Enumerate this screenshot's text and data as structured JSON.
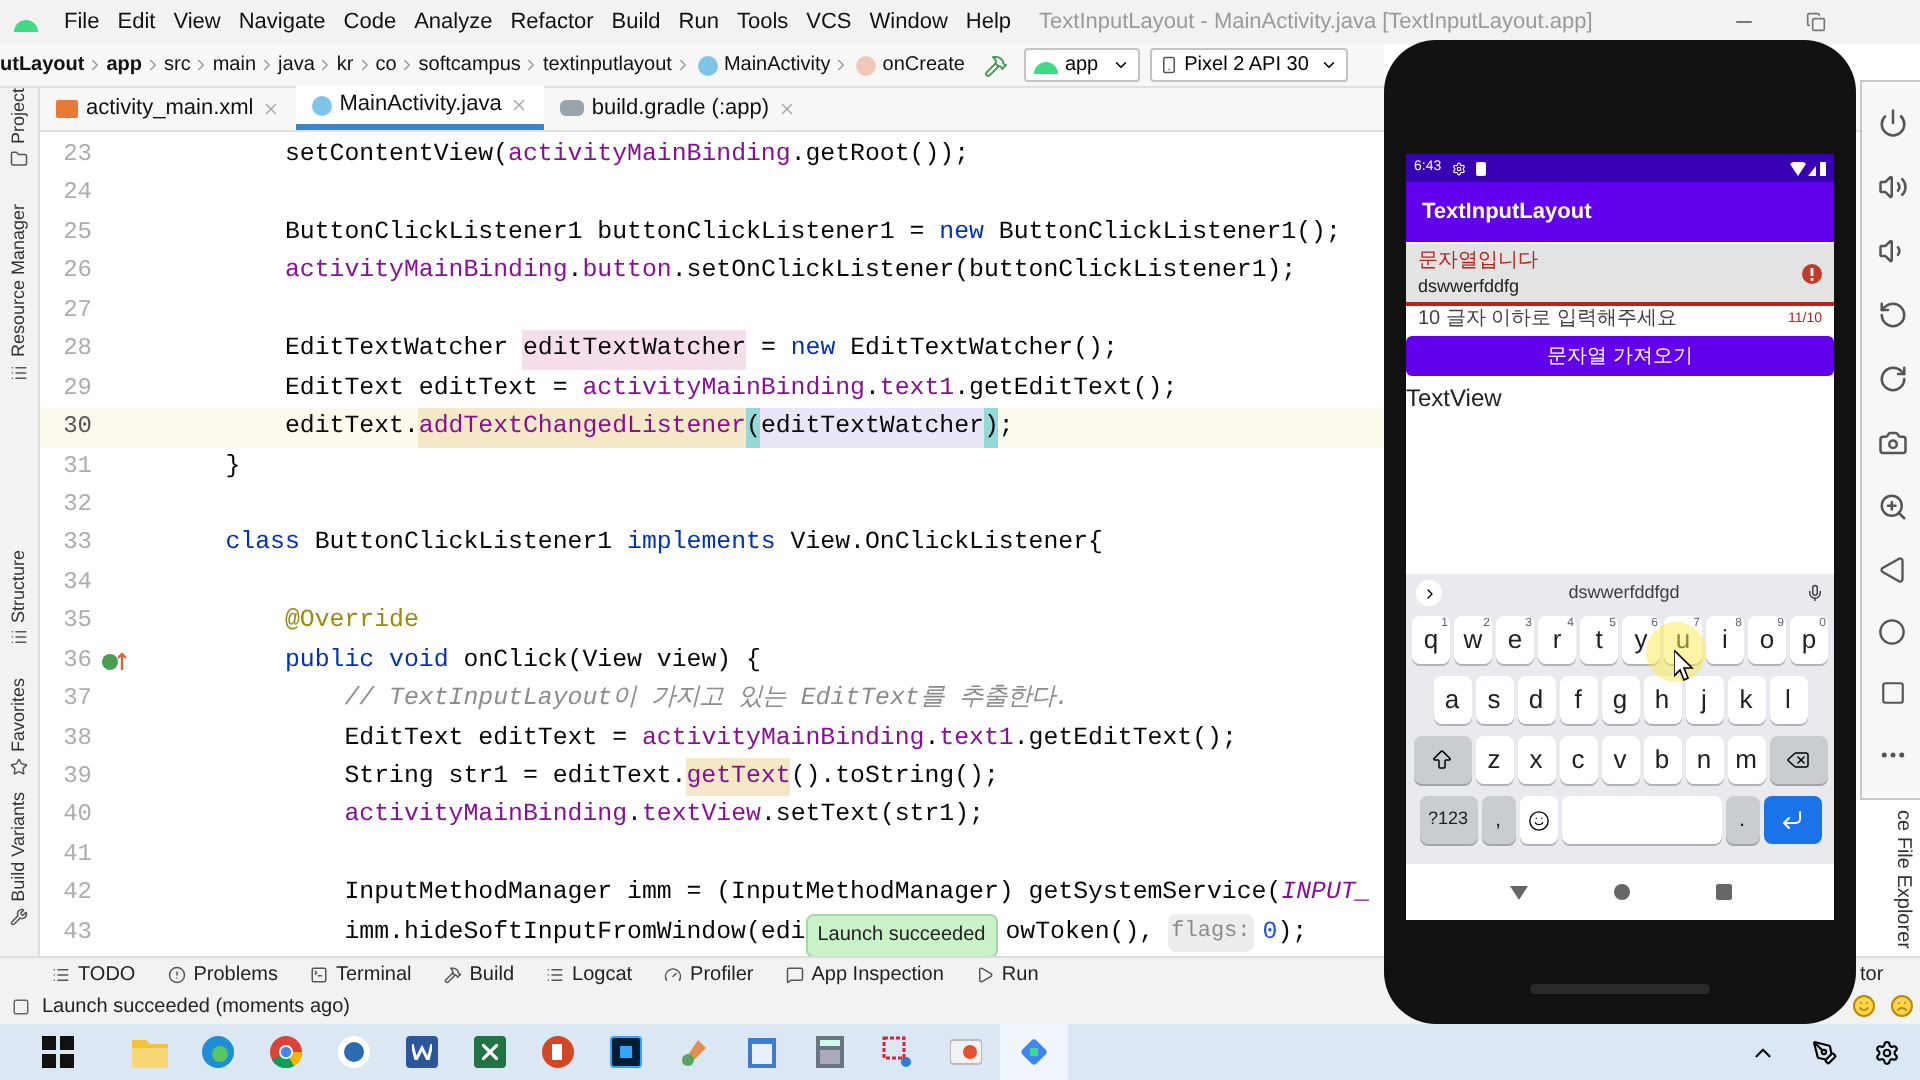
{
  "title_bar": {
    "menu": [
      "File",
      "Edit",
      "View",
      "Navigate",
      "Code",
      "Analyze",
      "Refactor",
      "Build",
      "Run",
      "Tools",
      "VCS",
      "Window",
      "Help"
    ],
    "title": "TextInputLayout - MainActivity.java [TextInputLayout.app]"
  },
  "nav_bar": {
    "breadcrumbs": [
      {
        "label": "utLayout",
        "kind": "project"
      },
      {
        "label": "app",
        "kind": "module"
      },
      {
        "label": "src",
        "kind": "dir"
      },
      {
        "label": "main",
        "kind": "dir"
      },
      {
        "label": "java",
        "kind": "dir"
      },
      {
        "label": "kr",
        "kind": "dir"
      },
      {
        "label": "co",
        "kind": "dir"
      },
      {
        "label": "softcampus",
        "kind": "dir"
      },
      {
        "label": "textinputlayout",
        "kind": "dir"
      },
      {
        "label": "MainActivity",
        "kind": "class"
      },
      {
        "label": "onCreate",
        "kind": "method"
      }
    ],
    "run_config": "app",
    "device": "Pixel 2 API 30"
  },
  "left_strip": [
    "Project",
    "Resource Manager",
    "Structure",
    "Favorites",
    "Build Variants"
  ],
  "tabs": [
    {
      "label": "activity_main.xml",
      "kind": "xml",
      "selected": false
    },
    {
      "label": "MainActivity.java",
      "kind": "class",
      "selected": true
    },
    {
      "label": "build.gradle (:app)",
      "kind": "gradle",
      "selected": false
    }
  ],
  "editor": {
    "lines": [
      {
        "num": "23",
        "current": false,
        "tokens": [
          {
            "text": "        setContentView(",
            "kind": "plain"
          },
          {
            "text": "activityMainBinding",
            "kind": "field"
          },
          {
            "text": ".getRoot());",
            "kind": "plain"
          }
        ]
      },
      {
        "num": "24",
        "current": false
      },
      {
        "num": "25",
        "current": false,
        "tokens": [
          {
            "text": "        ButtonClickListener1 buttonClickListener1 = ",
            "kind": "plain"
          },
          {
            "text": "new",
            "kind": "keyword"
          },
          {
            "text": " ButtonClickListener1();",
            "kind": "plain"
          }
        ]
      },
      {
        "num": "26",
        "current": false,
        "tokens": [
          {
            "text": "        activityMainBinding",
            "kind": "field"
          },
          {
            "text": ".",
            "kind": "plain"
          },
          {
            "text": "button",
            "kind": "field"
          },
          {
            "text": ".setOnClickListener(buttonClickListener1);",
            "kind": "plain"
          }
        ]
      },
      {
        "num": "27",
        "current": false
      },
      {
        "num": "28",
        "current": false,
        "tokens": [
          {
            "text": "        EditTextWatcher ",
            "kind": "plain"
          },
          {
            "text": "editTextWatcher",
            "kind": "declaration"
          },
          {
            "text": " = ",
            "kind": "plain"
          },
          {
            "text": "new",
            "kind": "keyword"
          },
          {
            "text": " EditTextWatcher();",
            "kind": "plain"
          }
        ]
      },
      {
        "num": "29",
        "current": false,
        "tokens": [
          {
            "text": "        EditText editText = ",
            "kind": "plain"
          },
          {
            "text": "activityMainBinding",
            "kind": "field"
          },
          {
            "text": ".",
            "kind": "plain"
          },
          {
            "text": "text1",
            "kind": "field"
          },
          {
            "text": ".getEditText();",
            "kind": "plain"
          }
        ]
      },
      {
        "num": "30",
        "current": true,
        "tokens": [
          {
            "text": "        editText.",
            "kind": "plain"
          },
          {
            "text": "addTextChangedListener",
            "kind": "usage"
          },
          {
            "text": "(",
            "kind": "brace"
          },
          {
            "text": "editTextWatcher",
            "kind": "argument"
          },
          {
            "text": ")",
            "kind": "brace"
          },
          {
            "text": ";",
            "kind": "plain"
          }
        ]
      },
      {
        "num": "31",
        "current": false,
        "tokens": [
          {
            "text": "    }",
            "kind": "plain"
          }
        ]
      },
      {
        "num": "32",
        "current": false
      },
      {
        "num": "33",
        "current": false,
        "tokens": [
          {
            "text": "    class",
            "kind": "keyword"
          },
          {
            "text": " ButtonClickListener1 ",
            "kind": "plain"
          },
          {
            "text": "implements",
            "kind": "keyword"
          },
          {
            "text": " View.OnClickListener{",
            "kind": "plain"
          }
        ]
      },
      {
        "num": "34",
        "current": false
      },
      {
        "num": "35",
        "current": false,
        "tokens": [
          {
            "text": "        @Override",
            "kind": "annotation"
          }
        ]
      },
      {
        "num": "36",
        "current": false,
        "gutter": {
          "kind": "override"
        },
        "tokens": [
          {
            "text": "        public",
            "kind": "keyword"
          },
          {
            "text": " void",
            "kind": "keyword"
          },
          {
            "text": " onClick(View view) {",
            "kind": "plain"
          }
        ]
      },
      {
        "num": "37",
        "current": false,
        "tokens": [
          {
            "text": "            // TextInputLayout이 가지고 있는 EditText를 추출한다.",
            "kind": "comment"
          }
        ]
      },
      {
        "num": "38",
        "current": false,
        "tokens": [
          {
            "text": "            EditText editText = ",
            "kind": "plain"
          },
          {
            "text": "activityMainBinding",
            "kind": "field"
          },
          {
            "text": ".",
            "kind": "plain"
          },
          {
            "text": "text1",
            "kind": "field"
          },
          {
            "text": ".getEditText();",
            "kind": "plain"
          }
        ]
      },
      {
        "num": "39",
        "current": false,
        "tokens": [
          {
            "text": "            String str1 = editText.",
            "kind": "plain"
          },
          {
            "text": "getText",
            "kind": "usage"
          },
          {
            "text": "().toString();",
            "kind": "plain"
          }
        ]
      },
      {
        "num": "40",
        "current": false,
        "tokens": [
          {
            "text": "            activityMainBinding",
            "kind": "field"
          },
          {
            "text": ".",
            "kind": "plain"
          },
          {
            "text": "textView",
            "kind": "field"
          },
          {
            "text": ".setText(str1);",
            "kind": "plain"
          }
        ]
      },
      {
        "num": "41",
        "current": false
      },
      {
        "num": "42",
        "current": false,
        "tokens": [
          {
            "text": "            InputMethodManager imm = (InputMethodManager) getSystemService(",
            "kind": "plain"
          },
          {
            "text": "INPUT_",
            "kind": "constant"
          }
        ]
      },
      {
        "num": "43",
        "current": false,
        "tokens": [
          {
            "text": "            imm.hideSoftInputFromWindow(edi",
            "kind": "plain"
          }
        ],
        "tooltip": "Launch succeeded",
        "tokens_after": [
          {
            "text": "owToken(),",
            "kind": "plain"
          },
          {
            "text": "flags:",
            "kind": "hint"
          },
          {
            "text": "0",
            "kind": "number"
          },
          {
            "text": ");",
            "kind": "plain"
          }
        ]
      }
    ]
  },
  "tool_windows": [
    "TODO",
    "Problems",
    "Terminal",
    "Build",
    "Logcat",
    "Profiler",
    "App Inspection",
    "Run"
  ],
  "status_bar": {
    "message": "Launch succeeded (moments ago)",
    "right_fragment": "tor"
  },
  "right_strip": {
    "label": "ce File Explorer"
  },
  "phone": {
    "time": "6:43",
    "app_title": "TextInputLayout",
    "field": {
      "label": "문자열입니다",
      "value": "dswwerfddfg",
      "error": true,
      "helper": "10 글자 이하로 입력해주세요",
      "counter": "11/10"
    },
    "button": "문자열 가져오기",
    "text_view": "TextView",
    "keyboard": {
      "suggestion": "dswwerfddfgd",
      "rows": [
        {
          "keys": [
            {
              "kind": "key",
              "label": "q",
              "hint": "1"
            },
            {
              "kind": "key",
              "label": "w",
              "hint": "2"
            },
            {
              "kind": "key",
              "label": "e",
              "hint": "3"
            },
            {
              "kind": "key",
              "label": "r",
              "hint": "4"
            },
            {
              "kind": "key",
              "label": "t",
              "hint": "5"
            },
            {
              "kind": "key",
              "label": "y",
              "hint": "6"
            },
            {
              "kind": "key",
              "label": "u",
              "hint": "7"
            },
            {
              "kind": "key",
              "label": "i",
              "hint": "8"
            },
            {
              "kind": "key",
              "label": "o",
              "hint": "9"
            },
            {
              "kind": "key",
              "label": "p",
              "hint": "0"
            }
          ]
        },
        {
          "keys": [
            {
              "kind": "key",
              "label": "a"
            },
            {
              "kind": "key",
              "label": "s"
            },
            {
              "kind": "key",
              "label": "d"
            },
            {
              "kind": "key",
              "label": "f"
            },
            {
              "kind": "key",
              "label": "g"
            },
            {
              "kind": "key",
              "label": "h"
            },
            {
              "kind": "key",
              "label": "j"
            },
            {
              "kind": "key",
              "label": "k"
            },
            {
              "kind": "key",
              "label": "l"
            }
          ]
        },
        {
          "keys": [
            {
              "kind": "shift"
            },
            {
              "kind": "key",
              "label": "z"
            },
            {
              "kind": "key",
              "label": "x"
            },
            {
              "kind": "key",
              "label": "c"
            },
            {
              "kind": "key",
              "label": "v"
            },
            {
              "kind": "key",
              "label": "b"
            },
            {
              "kind": "key",
              "label": "n"
            },
            {
              "kind": "key",
              "label": "m"
            },
            {
              "kind": "backspace"
            }
          ]
        },
        {
          "keys": [
            {
              "kind": "symbols",
              "label": "?123"
            },
            {
              "kind": "mod",
              "label": ","
            },
            {
              "kind": "emoji"
            },
            {
              "kind": "space"
            },
            {
              "kind": "mod",
              "label": "."
            },
            {
              "kind": "enter"
            }
          ]
        }
      ]
    }
  },
  "taskbar": [
    {
      "kind": "start",
      "selected": false
    },
    {
      "kind": "files",
      "selected": false
    },
    {
      "kind": "edge",
      "selected": false
    },
    {
      "kind": "chrome",
      "selected": false
    },
    {
      "kind": "app",
      "selected": false
    },
    {
      "kind": "word",
      "selected": false
    },
    {
      "kind": "excel",
      "selected": false
    },
    {
      "kind": "powerpoint",
      "selected": false
    },
    {
      "kind": "photoshop",
      "selected": false
    },
    {
      "kind": "paint",
      "selected": false
    },
    {
      "kind": "notepad",
      "selected": false
    },
    {
      "kind": "calculator",
      "selected": false
    },
    {
      "kind": "snip",
      "selected": false
    },
    {
      "kind": "media",
      "selected": false
    },
    {
      "kind": "studio",
      "selected": true
    }
  ]
}
